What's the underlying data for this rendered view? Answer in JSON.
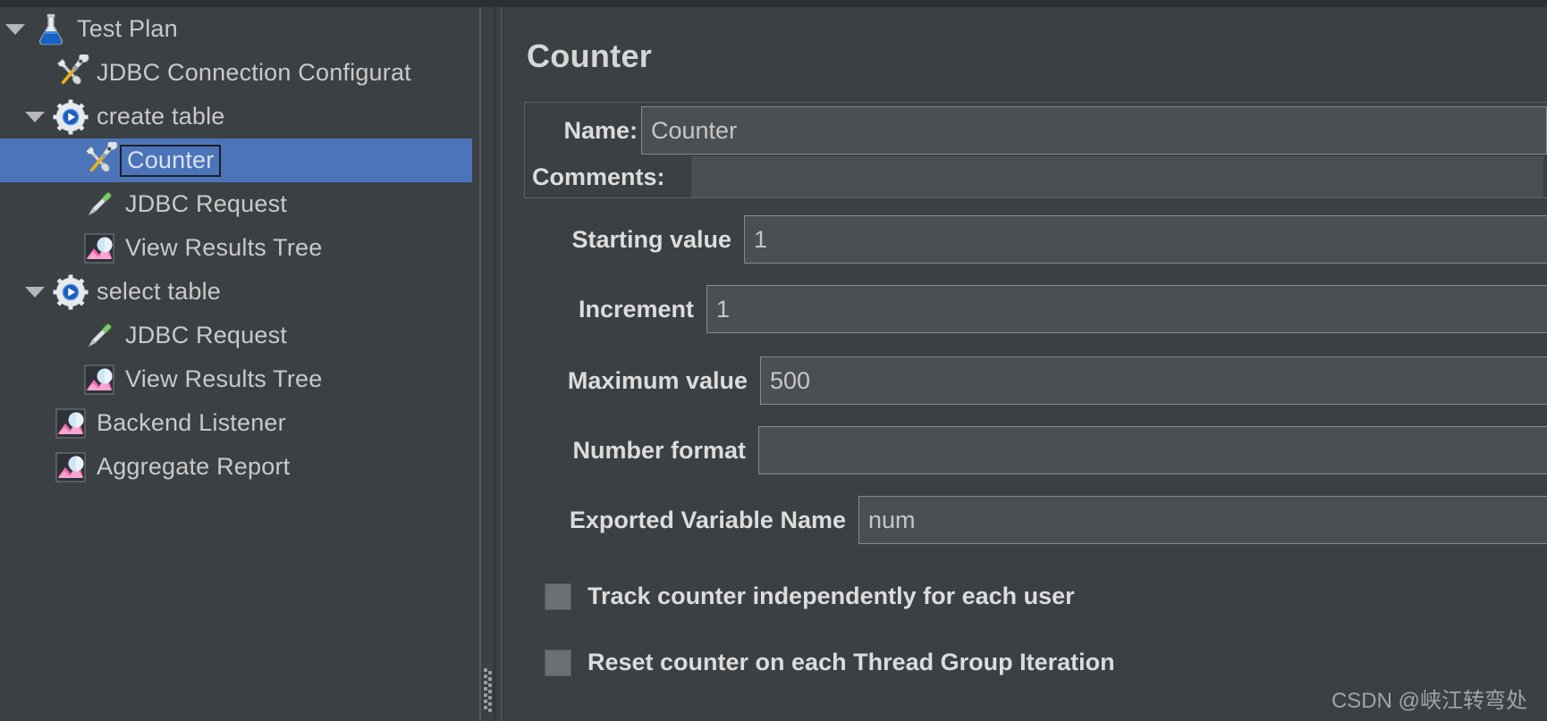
{
  "colors": {
    "background": "#3b4044",
    "selection": "#4c74b9",
    "field_background": "#4a4f53",
    "field_border": "#868b8f",
    "label_text": "#dcdcdc",
    "tree_text": "#c9c9c9"
  },
  "tree": {
    "name": "Test Plan Tree",
    "items": [
      {
        "label": "Test Plan",
        "icon": "flask-icon",
        "depth": 0,
        "expanded": true,
        "selected": false,
        "has_toggle": true
      },
      {
        "label": "JDBC Connection Configurat",
        "icon": "config-tools-icon",
        "depth": 1,
        "expanded": false,
        "selected": false,
        "has_toggle": false
      },
      {
        "label": "create table",
        "icon": "thread-group-icon",
        "depth": 1,
        "expanded": true,
        "selected": false,
        "has_toggle": true
      },
      {
        "label": "Counter",
        "icon": "config-tools-icon",
        "depth": 2,
        "expanded": false,
        "selected": true,
        "has_toggle": false
      },
      {
        "label": "JDBC Request",
        "icon": "sampler-icon",
        "depth": 2,
        "expanded": false,
        "selected": false,
        "has_toggle": false
      },
      {
        "label": "View Results Tree",
        "icon": "listener-icon",
        "depth": 2,
        "expanded": false,
        "selected": false,
        "has_toggle": false
      },
      {
        "label": "select table",
        "icon": "thread-group-icon",
        "depth": 1,
        "expanded": true,
        "selected": false,
        "has_toggle": true
      },
      {
        "label": "JDBC Request",
        "icon": "sampler-icon",
        "depth": 2,
        "expanded": false,
        "selected": false,
        "has_toggle": false
      },
      {
        "label": "View Results Tree",
        "icon": "listener-icon",
        "depth": 2,
        "expanded": false,
        "selected": false,
        "has_toggle": false
      },
      {
        "label": "Backend Listener",
        "icon": "listener-icon",
        "depth": 1,
        "expanded": false,
        "selected": false,
        "has_toggle": false
      },
      {
        "label": "Aggregate Report",
        "icon": "listener-icon",
        "depth": 1,
        "expanded": false,
        "selected": false,
        "has_toggle": false
      }
    ]
  },
  "panel": {
    "title": "Counter",
    "name_label": "Name:",
    "name_value": "Counter",
    "comments_label": "Comments:",
    "comments_value": "",
    "fields": [
      {
        "label": "Starting value",
        "value": "1"
      },
      {
        "label": "Increment",
        "value": "1"
      },
      {
        "label": "Maximum value",
        "value": "500"
      },
      {
        "label": "Number format",
        "value": ""
      },
      {
        "label": "Exported Variable Name",
        "value": "num"
      }
    ],
    "checkboxes": [
      {
        "label": "Track counter independently for each user",
        "checked": false
      },
      {
        "label": "Reset counter on each Thread Group Iteration",
        "checked": false
      }
    ]
  },
  "watermark": {
    "text": "CSDN @峡江转弯处"
  }
}
